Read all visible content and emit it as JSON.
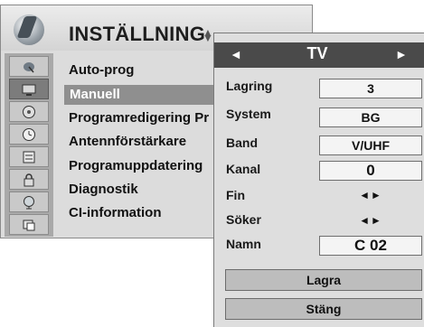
{
  "menu": {
    "title": "INSTÄLLNING",
    "nav_hint_icon": "updown-arrows-icon",
    "icons": [
      "satellite-dish-icon",
      "tv-screen-icon",
      "disc-icon",
      "clock-icon",
      "keyboard-icon",
      "lock-icon",
      "globe-icon",
      "options-icon"
    ],
    "items": [
      {
        "label": "Auto-prog"
      },
      {
        "label": "Manuell"
      },
      {
        "label": "Programredigering Pr"
      },
      {
        "label": "Antennförstärkare"
      },
      {
        "label": "Programuppdatering"
      },
      {
        "label": "Diagnostik"
      },
      {
        "label": "CI-information"
      }
    ],
    "selected_item": "Manuell"
  },
  "panel": {
    "header_title": "TV",
    "rows": {
      "lagring": {
        "label": "Lagring",
        "value": "3"
      },
      "system": {
        "label": "System",
        "value": "BG"
      },
      "band": {
        "label": "Band",
        "value": "V/UHF"
      },
      "kanal": {
        "label": "Kanal",
        "value": "0"
      },
      "fin": {
        "label": "Fin",
        "value": "◄►"
      },
      "soker": {
        "label": "Söker",
        "value": "◄►"
      },
      "namn": {
        "label": "Namn",
        "value": "C  02"
      }
    },
    "buttons": {
      "save": "Lagra",
      "close": "Stäng"
    }
  }
}
